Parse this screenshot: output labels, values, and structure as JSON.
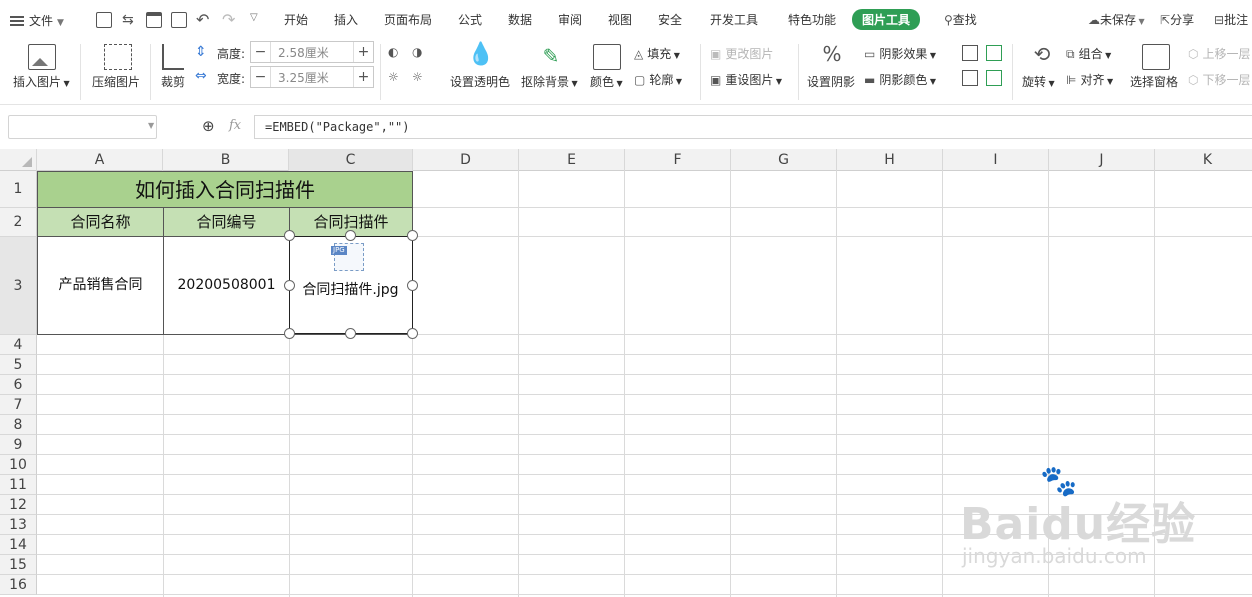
{
  "menubar": {
    "file_label": "文件",
    "tabs": [
      "开始",
      "插入",
      "页面布局",
      "公式",
      "数据",
      "审阅",
      "视图",
      "安全",
      "开发工具",
      "特色功能",
      "图片工具"
    ],
    "active_tab": "图片工具",
    "search_label": "查找",
    "unsaved_label": "未保存",
    "share_label": "分享",
    "comment_label": "批注"
  },
  "ribbon": {
    "insert_picture": "插入图片",
    "compress_picture": "压缩图片",
    "crop": "裁剪",
    "height_label": "高度:",
    "height_value": "2.58厘米",
    "width_label": "宽度:",
    "width_value": "3.25厘米",
    "set_transparent": "设置透明色",
    "remove_background": "抠除背景",
    "color": "颜色",
    "fill": "填充",
    "outline": "轮廓",
    "change_picture": "更改图片",
    "reset_picture": "重设图片",
    "set_shadow": "设置阴影",
    "shadow_effect": "阴影效果",
    "shadow_color": "阴影颜色",
    "rotate": "旋转",
    "group": "组合",
    "align": "对齐",
    "selection_pane": "选择窗格",
    "bring_forward": "上移一层",
    "send_backward": "下移一层"
  },
  "formula_bar": {
    "namebox_value": "",
    "fx_label": "fx",
    "formula": "=EMBED(\"Package\",\"\")"
  },
  "sheet": {
    "columns": [
      "A",
      "B",
      "C",
      "D",
      "E",
      "F",
      "G",
      "H",
      "I",
      "J",
      "K"
    ],
    "rows": [
      "1",
      "2",
      "3",
      "4",
      "5",
      "6",
      "7",
      "8",
      "9",
      "10",
      "11",
      "12",
      "13",
      "14",
      "15",
      "16"
    ],
    "title": "如何插入合同扫描件",
    "headers": [
      "合同名称",
      "合同编号",
      "合同扫描件"
    ],
    "row3": [
      "产品销售合同",
      "20200508001"
    ],
    "embedded_file_name": "合同扫描件.jpg",
    "embedded_file_ext": "JPG"
  },
  "watermark": {
    "brand": "Baidu经验",
    "url": "jingyan.baidu.com"
  },
  "colors": {
    "active_tab": "#2f9e55",
    "title_fill": "#a9d18e",
    "header_fill": "#c5e0b4"
  }
}
